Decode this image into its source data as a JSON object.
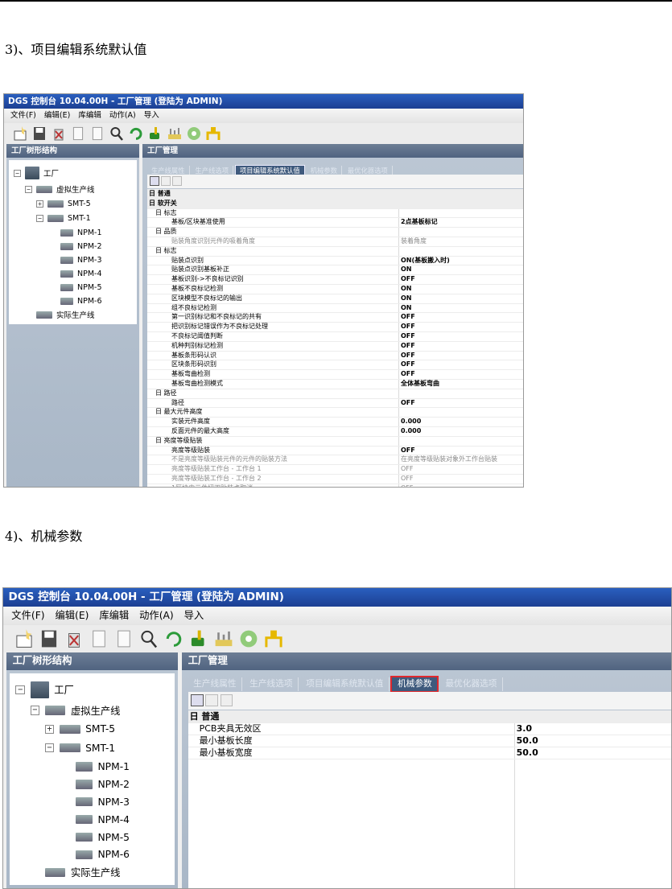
{
  "doc": {
    "heading3": "3)、项目编辑系统默认值",
    "heading4": "4)、机械参数"
  },
  "app": {
    "title": "DGS 控制台 10.04.00H - 工厂管理 (登陆为 ADMIN)",
    "menu": [
      "文件(F)",
      "编辑(E)",
      "库编辑",
      "动作(A)",
      "导入"
    ],
    "toolbar_icons": [
      "new-icon",
      "save-icon",
      "delete-icon",
      "copy-icon",
      "paste-icon",
      "find-icon",
      "refresh-icon",
      "tools-icon",
      "chart-icon",
      "parts-icon",
      "gripper-icon"
    ],
    "left_panel_title": "工厂树形结构",
    "right_panel_title": "工厂管理",
    "tabs": [
      "生产线属性",
      "生产线选项",
      "项目编辑系统默认值",
      "机械参数",
      "最优化器选项"
    ],
    "tree": {
      "factory": "工厂",
      "virtual_line": "虚拟生产线",
      "smt5": "SMT-5",
      "smt1": "SMT-1",
      "machines": [
        "NPM-1",
        "NPM-2",
        "NPM-3",
        "NPM-4",
        "NPM-5",
        "NPM-6"
      ],
      "real_line": "实际生产线"
    }
  },
  "shot1": {
    "active_tab": 2,
    "rows": [
      {
        "t": "cat",
        "k": "日 普通",
        "v": ""
      },
      {
        "t": "cat",
        "k": "日 软开关",
        "v": ""
      },
      {
        "t": "sub",
        "k": "日 标志",
        "v": ""
      },
      {
        "t": "item",
        "k": "基板/区块基准使用",
        "v": "2点基板标记"
      },
      {
        "t": "sub",
        "k": "日 品质",
        "v": ""
      },
      {
        "t": "dim",
        "k": "贴装角度识别元件的吸着角度",
        "v": "装着角度"
      },
      {
        "t": "sub",
        "k": "日 标志",
        "v": ""
      },
      {
        "t": "item",
        "k": "贴装点识别",
        "v": "ON(基板搬入时)"
      },
      {
        "t": "item",
        "k": "贴装点识别基板补正",
        "v": "ON"
      },
      {
        "t": "item",
        "k": "基板识别->不良标记识别",
        "v": "OFF"
      },
      {
        "t": "item",
        "k": "基板不良标记检测",
        "v": "ON"
      },
      {
        "t": "item",
        "k": "区块模型不良标记的输出",
        "v": "ON"
      },
      {
        "t": "item",
        "k": "组不良标记检测",
        "v": "ON"
      },
      {
        "t": "item",
        "k": "第一识别标记和不良标记的共有",
        "v": "OFF"
      },
      {
        "t": "item",
        "k": "把识别标记错误作为不良标记处理",
        "v": "OFF"
      },
      {
        "t": "item",
        "k": "不良标记阈值判断",
        "v": "OFF"
      },
      {
        "t": "item",
        "k": "机种判别标记检测",
        "v": "OFF"
      },
      {
        "t": "item",
        "k": "基板条形码认识",
        "v": "OFF"
      },
      {
        "t": "item",
        "k": "区块条形码识别",
        "v": "OFF"
      },
      {
        "t": "item",
        "k": "基板弯曲检测",
        "v": "OFF"
      },
      {
        "t": "item",
        "k": "基板弯曲检测模式",
        "v": "全体基板弯曲"
      },
      {
        "t": "sub",
        "k": "日 路径",
        "v": ""
      },
      {
        "t": "item",
        "k": "路径",
        "v": "OFF"
      },
      {
        "t": "sub",
        "k": "日 最大元件高度",
        "v": ""
      },
      {
        "t": "item",
        "k": "实装元件高度",
        "v": "0.000"
      },
      {
        "t": "item",
        "k": "反面元件的最大高度",
        "v": "0.000"
      },
      {
        "t": "sub",
        "k": "日 亮度等级贴装",
        "v": ""
      },
      {
        "t": "item",
        "k": "亮度等级贴装",
        "v": "OFF"
      },
      {
        "t": "dim",
        "k": "不是亮度等级贴装元件的元件的贴装方法",
        "v": "在亮度等级贴装对象外工作台贴装"
      },
      {
        "t": "dim",
        "k": "亮度等级贴装工作台 - 工作台 1",
        "v": "OFF"
      },
      {
        "t": "dim",
        "k": "亮度等级贴装工作台 - 工作台 2",
        "v": "OFF"
      },
      {
        "t": "dim",
        "k": "1区块中元件扭双贴装点取消",
        "v": "OFF"
      }
    ]
  },
  "shot2": {
    "active_tab": 3,
    "rows": [
      {
        "t": "cat",
        "k": "日 普通",
        "v": ""
      },
      {
        "t": "item",
        "k": "PCB夹具无效区",
        "v": "3.0"
      },
      {
        "t": "item",
        "k": "最小基板长度",
        "v": "50.0"
      },
      {
        "t": "item",
        "k": "最小基板宽度",
        "v": "50.0"
      }
    ]
  },
  "colors": {
    "title": "#2a5fbf",
    "panel": "#b6c2d0",
    "highlight": "#e0282d"
  }
}
